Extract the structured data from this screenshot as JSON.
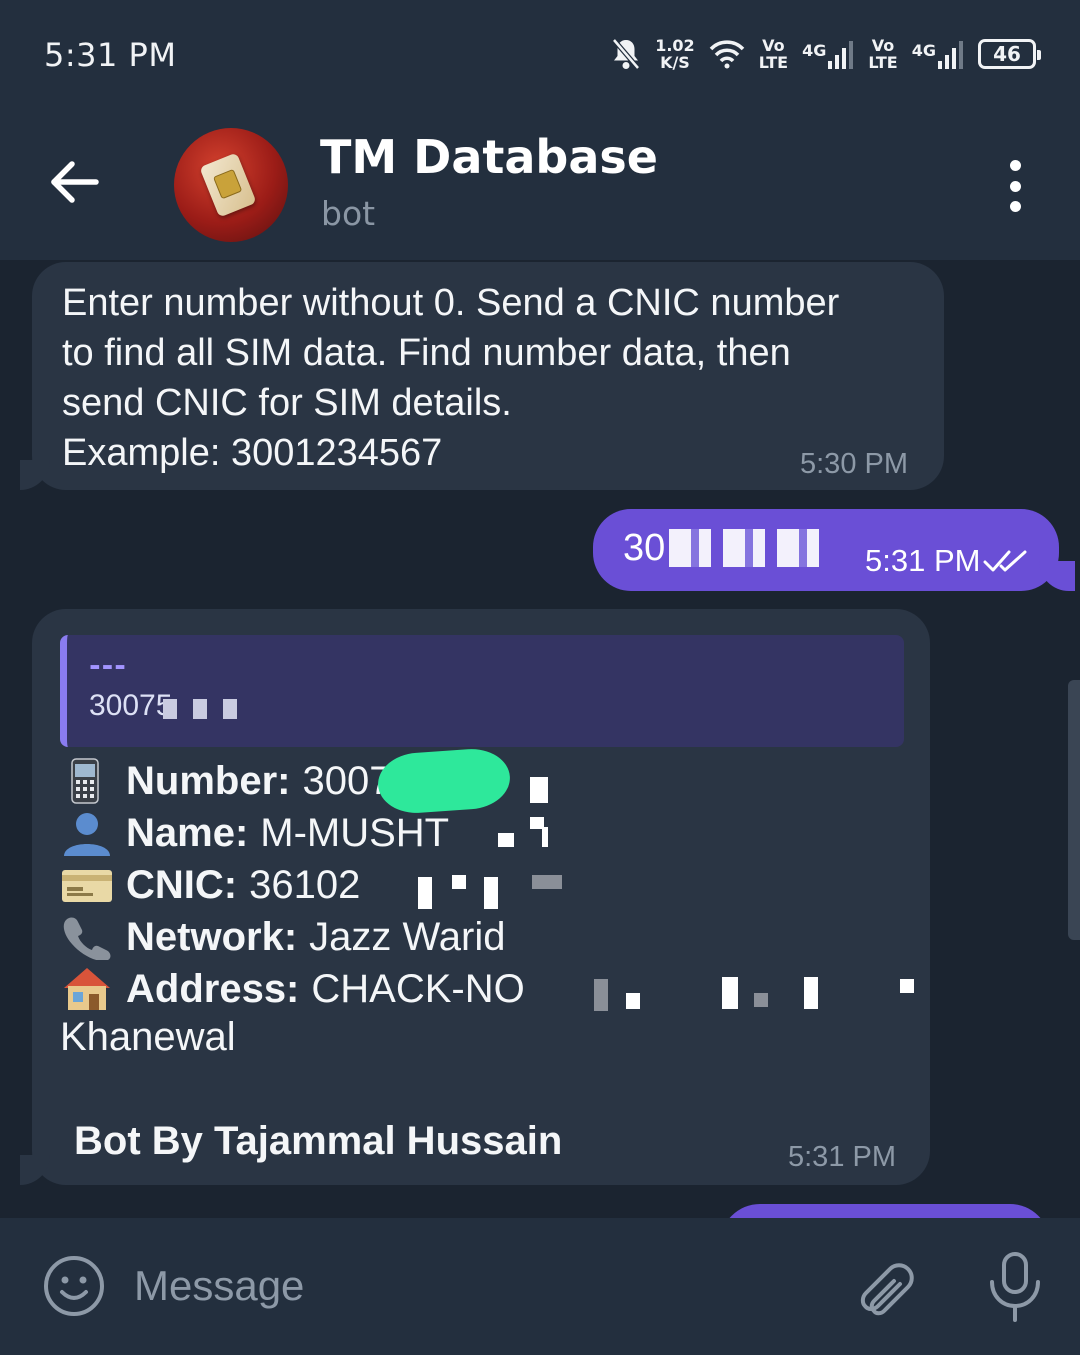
{
  "status_bar": {
    "time": "5:31 PM",
    "net_speed_value": "1.02",
    "net_speed_unit": "K/S",
    "sim1_volte_top": "Vo",
    "sim1_volte_bottom": "LTE",
    "sim1_network": "4G",
    "sim2_volte_top": "Vo",
    "sim2_volte_bottom": "LTE",
    "sim2_network": "4G",
    "battery": "46",
    "icons": [
      "bell-off-icon",
      "wifi-icon",
      "signal-icon",
      "battery-icon"
    ]
  },
  "header": {
    "title": "TM Database",
    "subtitle": "bot",
    "icons": [
      "back-arrow-icon",
      "sim-card-avatar",
      "more-vertical-icon"
    ]
  },
  "messages": {
    "intro": {
      "lines": [
        "Enter number without 0. Send a CNIC number",
        "to find all SIM data. Find number data, then",
        "send CNIC for SIM details.",
        "Example: 3001234567"
      ],
      "time": "5:30 PM"
    },
    "sent": {
      "text_visible": "30",
      "time": "5:31 PM",
      "status_icon": "double-check-icon"
    },
    "result": {
      "quote_dash": "---",
      "quote_text": "30075",
      "rows": [
        {
          "icon": "mobile-phone-emoji",
          "label": "Number:",
          "value": "3007"
        },
        {
          "icon": "person-emoji",
          "label": "Name:",
          "value": "M-MUSHT"
        },
        {
          "icon": "credit-card-emoji",
          "label": "CNIC:",
          "value": "36102"
        },
        {
          "icon": "telephone-emoji",
          "label": "Network:",
          "value": "Jazz Warid"
        },
        {
          "icon": "house-emoji",
          "label": "Address:",
          "value": "CHACK-NO"
        }
      ],
      "address_continued": "Khanewal",
      "footer": "Bot By Tajammal Hussain",
      "time": "5:31 PM"
    }
  },
  "input": {
    "placeholder": "Message",
    "icons": [
      "emoji-icon",
      "paperclip-icon",
      "microphone-icon"
    ]
  },
  "colors": {
    "header_bg": "#232f3e",
    "chat_bg": "#1b2430",
    "incoming_bubble": "#2a3544",
    "outgoing_bubble": "#6a4fd6",
    "quote_bg": "#343463",
    "accent": "#8a7cf0"
  }
}
